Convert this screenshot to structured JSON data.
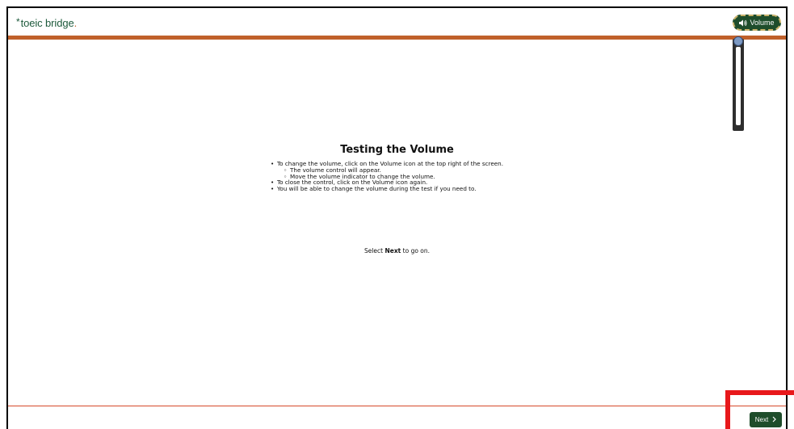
{
  "header": {
    "logo_text": "toeic bridge",
    "logo_star": "*",
    "logo_dot": ".",
    "volume_label": "Volume",
    "volume_icon": "speaker-icon"
  },
  "volume_slider": {
    "level": 1.0
  },
  "main": {
    "title": "Testing the Volume",
    "instructions": [
      "To change the volume, click on the Volume icon at the top right of the screen.",
      "The volume control will appear.",
      "Move the volume indicator to change the volume.",
      "To close the control, click on the Volume icon again.",
      "You will be able to change the volume during the test if you need to."
    ],
    "go_on_prefix": "Select ",
    "go_on_bold": "Next",
    "go_on_suffix": " to go on."
  },
  "footer": {
    "next_label": "Next",
    "next_icon": "chevron-right-icon"
  },
  "colors": {
    "brand_green": "#1e4d2b",
    "brand_orange": "#c0602a",
    "highlight_red": "#e8181b"
  }
}
